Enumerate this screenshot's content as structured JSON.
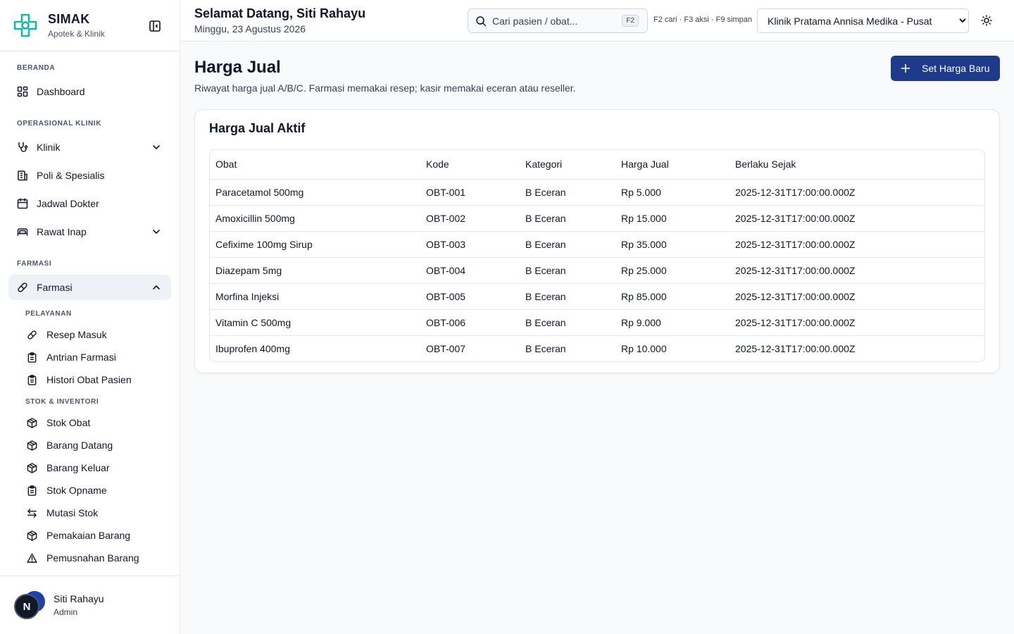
{
  "brand": {
    "name": "SIMAK",
    "subtitle": "Apotek & Klinik"
  },
  "header": {
    "greeting": "Selamat Datang, Siti Rahayu",
    "date": "Minggu, 23 Agustus 2026",
    "search_placeholder": "Cari pasien / obat...",
    "search_shortcut": "F2",
    "shortcuts_hint": "F2 cari · F3 aksi · F9 simpan",
    "clinic_selected": "Klinik Pratama Annisa Medika - Pusat"
  },
  "sidebar": {
    "sections": {
      "beranda": "BERANDA",
      "operasional": "OPERASIONAL KLINIK",
      "farmasi": "FARMASI",
      "pelayanan": "PELAYANAN",
      "stok": "STOK & INVENTORI"
    },
    "items": {
      "dashboard": "Dashboard",
      "klinik": "Klinik",
      "poli": "Poli & Spesialis",
      "jadwal": "Jadwal Dokter",
      "rawat_inap": "Rawat Inap",
      "farmasi": "Farmasi"
    },
    "pelayanan": [
      "Resep Masuk",
      "Antrian Farmasi",
      "Histori Obat Pasien"
    ],
    "stok": [
      "Stok Obat",
      "Barang Datang",
      "Barang Keluar",
      "Stok Opname",
      "Mutasi Stok",
      "Pemakaian Barang",
      "Pemusnahan Barang"
    ]
  },
  "user": {
    "initial": "N",
    "name": "Siti Rahayu",
    "role": "Admin"
  },
  "main": {
    "title": "Harga Jual",
    "subtitle": "Riwayat harga jual A/B/C. Farmasi memakai resep; kasir memakai eceran atau reseller.",
    "primary_button": "Set Harga Baru",
    "card_title": "Harga Jual Aktif",
    "columns": [
      "Obat",
      "Kode",
      "Kategori",
      "Harga Jual",
      "Berlaku Sejak"
    ],
    "rows": [
      [
        "Paracetamol 500mg",
        "OBT-001",
        "B Eceran",
        "Rp 5.000",
        "2025-12-31T17:00:00.000Z"
      ],
      [
        "Amoxicillin 500mg",
        "OBT-002",
        "B Eceran",
        "Rp 15.000",
        "2025-12-31T17:00:00.000Z"
      ],
      [
        "Cefixime 100mg Sirup",
        "OBT-003",
        "B Eceran",
        "Rp 35.000",
        "2025-12-31T17:00:00.000Z"
      ],
      [
        "Diazepam 5mg",
        "OBT-004",
        "B Eceran",
        "Rp 25.000",
        "2025-12-31T17:00:00.000Z"
      ],
      [
        "Morfina Injeksi",
        "OBT-005",
        "B Eceran",
        "Rp 85.000",
        "2025-12-31T17:00:00.000Z"
      ],
      [
        "Vitamin C 500mg",
        "OBT-006",
        "B Eceran",
        "Rp 9.000",
        "2025-12-31T17:00:00.000Z"
      ],
      [
        "Ibuprofen 400mg",
        "OBT-007",
        "B Eceran",
        "Rp 10.000",
        "2025-12-31T17:00:00.000Z"
      ]
    ]
  },
  "colors": {
    "primary": "#1e3a8a",
    "brand_green": "#14b8a6",
    "active_bg": "#eef2f7"
  }
}
